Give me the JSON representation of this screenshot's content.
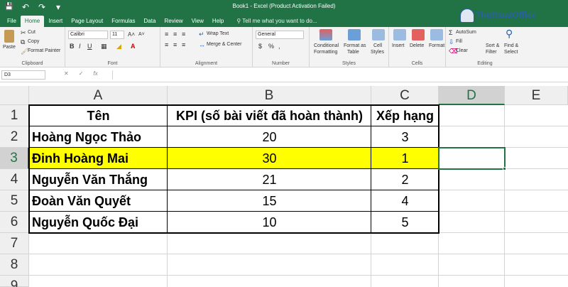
{
  "window": {
    "title": "Book1 - Excel (Product Activation Failed)",
    "qat": {
      "save_icon": "💾",
      "undo_icon": "↶",
      "redo_icon": "↷",
      "customize_icon": "▾"
    }
  },
  "tabs": [
    "File",
    "Home",
    "Insert",
    "Page Layout",
    "Formulas",
    "Data",
    "Review",
    "View",
    "Help"
  ],
  "tell_me": "Tell me what you want to do...",
  "ribbon": {
    "clipboard": {
      "paste": "Paste",
      "cut": "Cut",
      "copy": "Copy",
      "format_painter": "Format Painter",
      "label": "Clipboard"
    },
    "font": {
      "name": "Calibri",
      "size": "11",
      "bold": "B",
      "italic": "I",
      "underline": "U",
      "label": "Font"
    },
    "alignment": {
      "wrap_text": "Wrap Text",
      "merge_center": "Merge & Center",
      "label": "Alignment"
    },
    "number": {
      "format": "General",
      "currency": "$",
      "percent": "%",
      "comma": ",",
      "label": "Number"
    },
    "styles": {
      "conditional": "Conditional",
      "formatting": "Formatting",
      "format_as": "Format as",
      "table": "Table",
      "cell": "Cell",
      "cell_styles": "Styles",
      "label": "Styles"
    },
    "cells": {
      "insert": "Insert",
      "delete": "Delete",
      "format": "Format",
      "label": "Cells"
    },
    "editing": {
      "autosum": "AutoSum",
      "fill": "Fill",
      "clear": "Clear",
      "sort": "Sort &",
      "filter": "Filter",
      "find": "Find &",
      "select": "Select",
      "label": "Editing"
    }
  },
  "formula_bar": {
    "name_box": "D3",
    "cancel": "✕",
    "enter": "✓",
    "fx": "fx",
    "value": ""
  },
  "columns": [
    "A",
    "B",
    "C",
    "D",
    "E"
  ],
  "rows": [
    "1",
    "2",
    "3",
    "4",
    "5",
    "6",
    "7",
    "8",
    "9"
  ],
  "table": {
    "header": [
      "Tên",
      "KPI (số bài viết đã hoàn thành)",
      "Xếp hạng"
    ],
    "rows": [
      [
        "Hoàng Ngọc Thảo",
        "20",
        "3"
      ],
      [
        "Đinh Hoàng Mai",
        "30",
        "1"
      ],
      [
        "Nguyễn Văn Thắng",
        "21",
        "2"
      ],
      [
        "Đoàn Văn Quyết",
        "15",
        "4"
      ],
      [
        "Nguyễn Quốc Đại",
        "10",
        "5"
      ]
    ]
  },
  "highlight_color": "#ffff00",
  "accent_color": "#217346",
  "watermark": "ThuthuatOffice"
}
